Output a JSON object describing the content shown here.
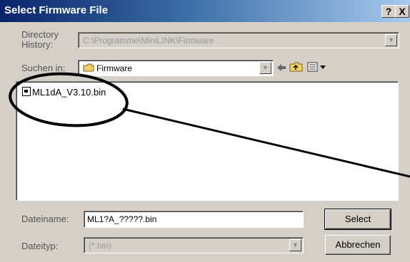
{
  "window": {
    "title": "Select Firmware File",
    "help_label": "?",
    "close_label": "X"
  },
  "history": {
    "label_line1": "Directory",
    "label_line2": "History:",
    "value": "C:\\Programme\\MiniLINK\\Firmware"
  },
  "lookin": {
    "label": "Suchen in:",
    "value": "Firmware"
  },
  "toolbar": {
    "back_icon": "back-arrow-icon",
    "up_icon": "up-folder-icon",
    "view_icon": "view-menu-icon"
  },
  "files": [
    {
      "name": "ML1dA_V3.10.bin"
    }
  ],
  "filename": {
    "label": "Dateiname:",
    "value": "ML1?A_?????.bin"
  },
  "filetype": {
    "label": "Dateityp:",
    "value": "(*.bin)"
  },
  "buttons": {
    "select": "Select",
    "cancel": "Abbrechen"
  },
  "colors": {
    "title_start": "#0a246a",
    "title_end": "#a6caf0",
    "dialog_bg": "#d4d0c8"
  }
}
